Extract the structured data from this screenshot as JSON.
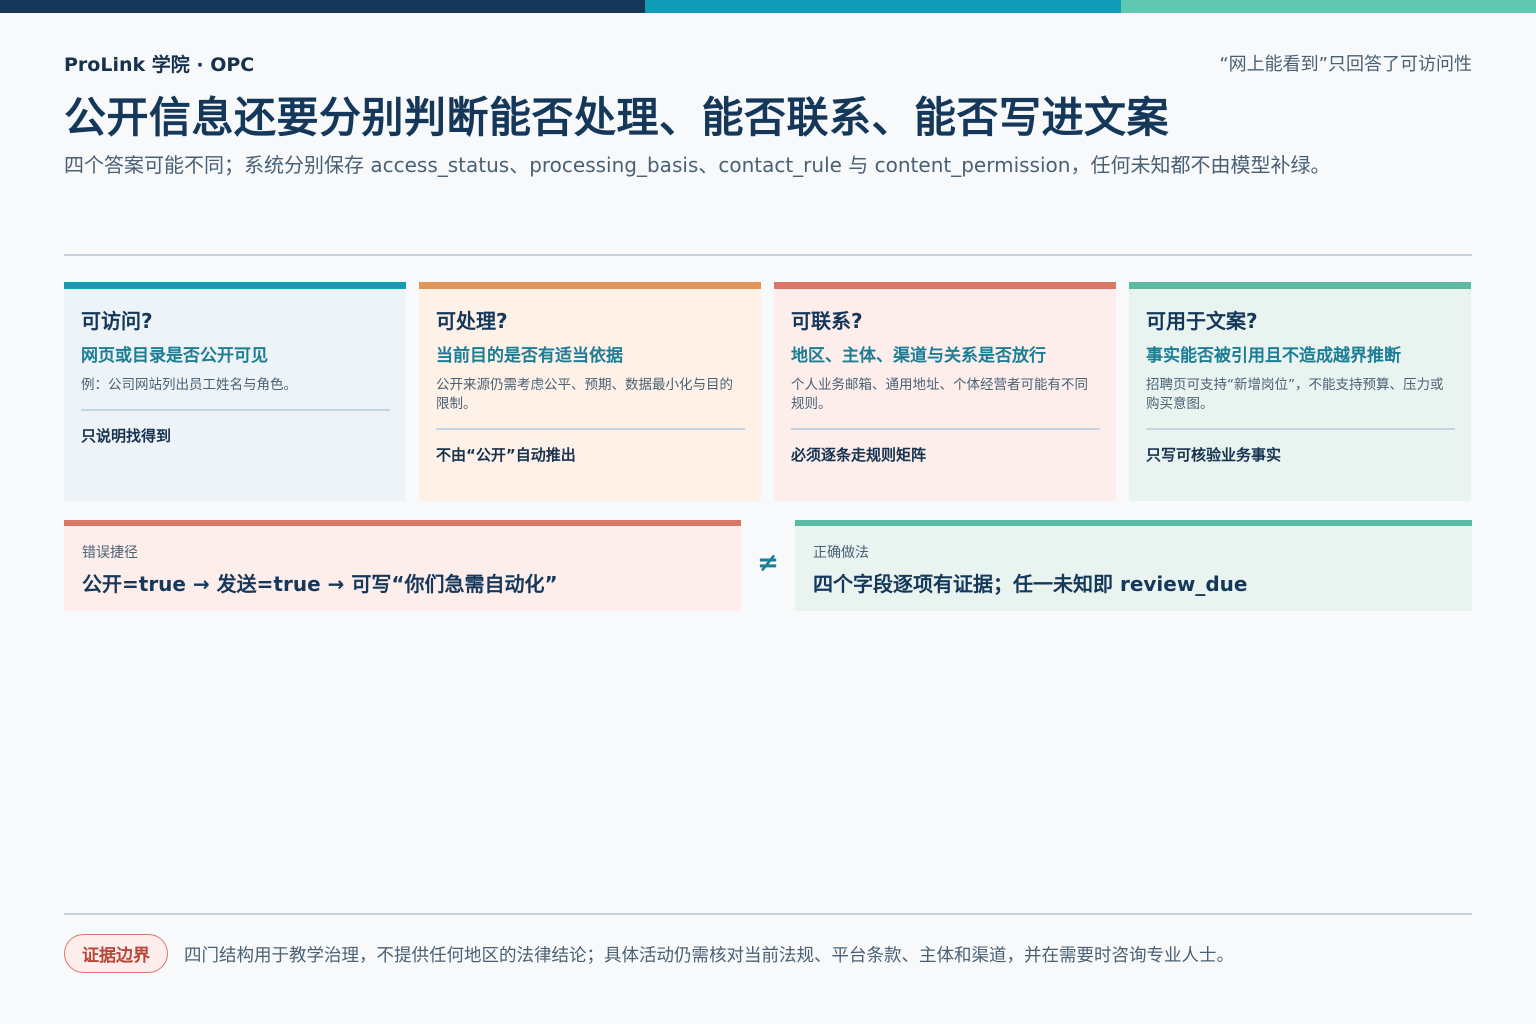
{
  "colors": {
    "navy": "#14375a",
    "teal": "#109cb6",
    "mint": "#5fc7b0",
    "orange": "#e0965a",
    "coral": "#db7769",
    "accent_text": "#1c7d95"
  },
  "header": {
    "brand": "ProLink 学院 · OPC",
    "tagline": "“网上能看到”只回答了可访问性",
    "title": "公开信息还要分别判断能否处理、能否联系、能否写进文案",
    "subtitle": "四个答案可能不同；系统分别保存 access_status、processing_basis、contact_rule 与 content_permission，任何未知都不由模型补绿。"
  },
  "cards": [
    {
      "question": "可访问?",
      "heading": "网页或目录是否公开可见",
      "example": "例：公司网站列出员工姓名与角色。",
      "verdict": "只说明找得到"
    },
    {
      "question": "可处理?",
      "heading": "当前目的是否有适当依据",
      "example": "公开来源仍需考虑公平、预期、数据最小化与目的限制。",
      "verdict": "不由“公开”自动推出"
    },
    {
      "question": "可联系?",
      "heading": "地区、主体、渠道与关系是否放行",
      "example": "个人业务邮箱、通用地址、个体经营者可能有不同规则。",
      "verdict": "必须逐条走规则矩阵"
    },
    {
      "question": "可用于文案?",
      "heading": "事实能否被引用且不造成越界推断",
      "example": "招聘页可支持“新增岗位”，不能支持预算、压力或购买意图。",
      "verdict": "只写可核验业务事实"
    }
  ],
  "comparison": {
    "wrong_label": "错误捷径",
    "wrong_text": "公开=true → 发送=true → 可写“你们急需自动化”",
    "symbol": "≠",
    "right_label": "正确做法",
    "right_text": "四个字段逐项有证据；任一未知即 review_due"
  },
  "footer": {
    "badge": "证据边界",
    "note": "四门结构用于教学治理，不提供任何地区的法律结论；具体活动仍需核对当前法规、平台条款、主体和渠道，并在需要时咨询专业人士。"
  }
}
